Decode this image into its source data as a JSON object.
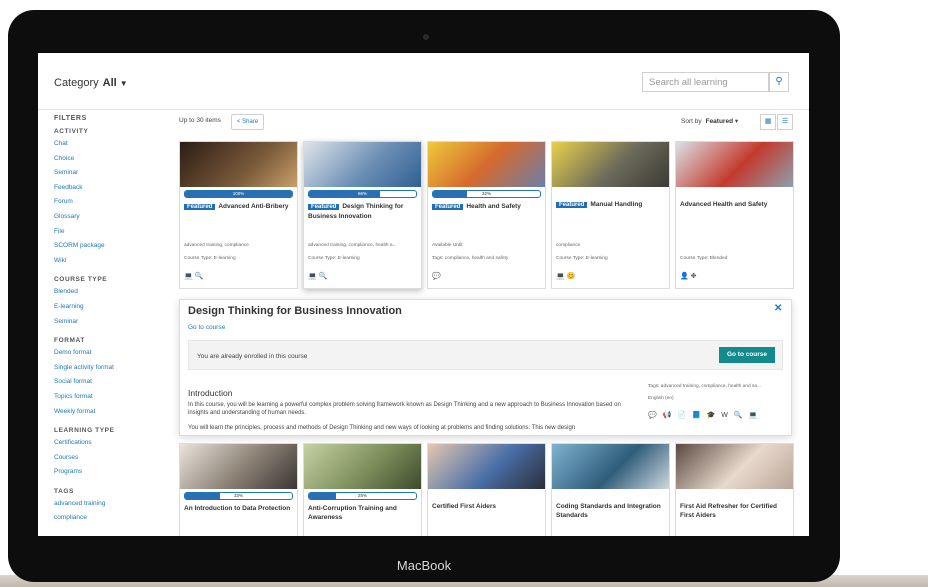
{
  "brand": "MacBook",
  "topbar": {
    "category_label": "Category",
    "category_value": "All",
    "search_placeholder": "Search all learning"
  },
  "filters": {
    "title": "FILTERS",
    "groups": [
      {
        "heading": "ACTIVITY",
        "items": [
          "Chat",
          "Choice",
          "Seminar",
          "Feedback",
          "Forum",
          "Glossary",
          "File",
          "SCORM package",
          "Wiki"
        ]
      },
      {
        "heading": "COURSE TYPE",
        "items": [
          "Blended",
          "E-learning",
          "Seminar"
        ]
      },
      {
        "heading": "FORMAT",
        "items": [
          "Demo format",
          "Single activity format",
          "Social format",
          "Topics format",
          "Weekly format"
        ]
      },
      {
        "heading": "LEARNING TYPE",
        "items": [
          "Certifications",
          "Courses",
          "Programs"
        ]
      },
      {
        "heading": "TAGS",
        "items": [
          "advanced training",
          "compliance"
        ]
      }
    ]
  },
  "results": {
    "count": "Up to 30 items",
    "share": "Share",
    "sort_label": "Sort by",
    "sort_value": "Featured"
  },
  "cards": [
    {
      "progress": 100,
      "progress_label": "100%",
      "featured": "Featured",
      "title": "Advanced Anti-Bribery",
      "tags": "advanced training, compliance",
      "type": "Course Type: E-learning",
      "icons": "💻 🔍"
    },
    {
      "progress": 66,
      "progress_label": "66%",
      "featured": "Featured",
      "title": "Design Thinking for Business Innovation",
      "tags": "advanced training, compliance, health a...",
      "type": "Course Type: E-learning",
      "icons": "💻 🔍"
    },
    {
      "progress": 32,
      "progress_label": "32%",
      "featured": "Featured",
      "title": "Health and Safety",
      "tags": "Available Until:",
      "type": "Tags: compliance, health and safety",
      "icons": "💬"
    },
    {
      "progress": null,
      "progress_label": "",
      "featured": "Featured",
      "title": "Manual Handling",
      "tags": "compliance",
      "type": "Course Type: E-learning",
      "icons": "💻 😊"
    },
    {
      "progress": null,
      "progress_label": "",
      "featured": "",
      "title": "Advanced Health and Safety",
      "tags": "",
      "type": "Course Type: Blended",
      "icons": "👤 ✥"
    }
  ],
  "detail": {
    "title": "Design Thinking for Business Innovation",
    "go_link": "Go to course",
    "enrolled_text": "You are already enrolled in this course",
    "enroll_button": "Go to course",
    "intro_heading": "Introduction",
    "para1": "In this course, you will be learning a powerful complex problem solving framework known as Design Thinking and a new approach to Business Innovation based on insights and understanding of human needs.",
    "para2": "You will learn the principles, process and methods of Design Thinking and new ways of looking at problems and finding solutions. This new design",
    "tags": "Tags: advanced training, compliance, health and sa...",
    "language": "English (en)",
    "icons": "💬 📢 📄 📘 🎓 W 🔍 💻"
  },
  "cards2": [
    {
      "progress": 33,
      "progress_label": "33%",
      "title": "An Introduction to Data Protection"
    },
    {
      "progress": 25,
      "progress_label": "25%",
      "title": "Anti-Corruption Training and Awareness"
    },
    {
      "progress": null,
      "progress_label": "",
      "title": "Certified First Aiders"
    },
    {
      "progress": null,
      "progress_label": "",
      "title": "Coding Standards and Integration Standards"
    },
    {
      "progress": null,
      "progress_label": "",
      "title": "First Aid Refresher for Certified First Aiders"
    }
  ],
  "colors": {
    "accent": "#1f78b4",
    "featured": "#1f6fb2",
    "button": "#138a8e"
  }
}
